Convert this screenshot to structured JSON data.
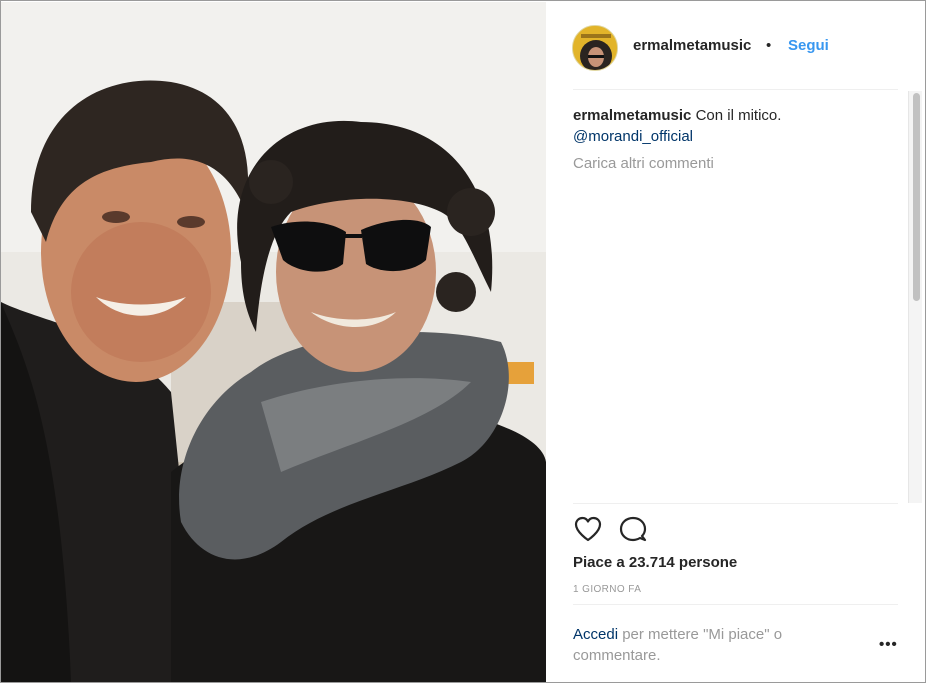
{
  "post": {
    "photo_alt": "",
    "header": {
      "username": "ermalmetamusic",
      "separator": "•",
      "follow_label": "Segui"
    },
    "caption": {
      "username": "ermalmetamusic",
      "text": "Con il mitico.",
      "mention": "@morandi_official"
    },
    "load_more_label": "Carica altri commenti",
    "likes_text": "Piace a 23.714 persone",
    "timestamp": "1 GIORNO FA",
    "login_prompt": {
      "link_label": "Accedi",
      "text": " per mettere \"Mi piace\" o commentare."
    },
    "options_label": "•••",
    "icons": {
      "like": "heart-icon",
      "comment": "comment-bubble-icon",
      "options": "more-options-icon"
    }
  },
  "colors": {
    "follow": "#3897f0",
    "link": "#003569",
    "muted": "#999999",
    "text": "#262626"
  }
}
